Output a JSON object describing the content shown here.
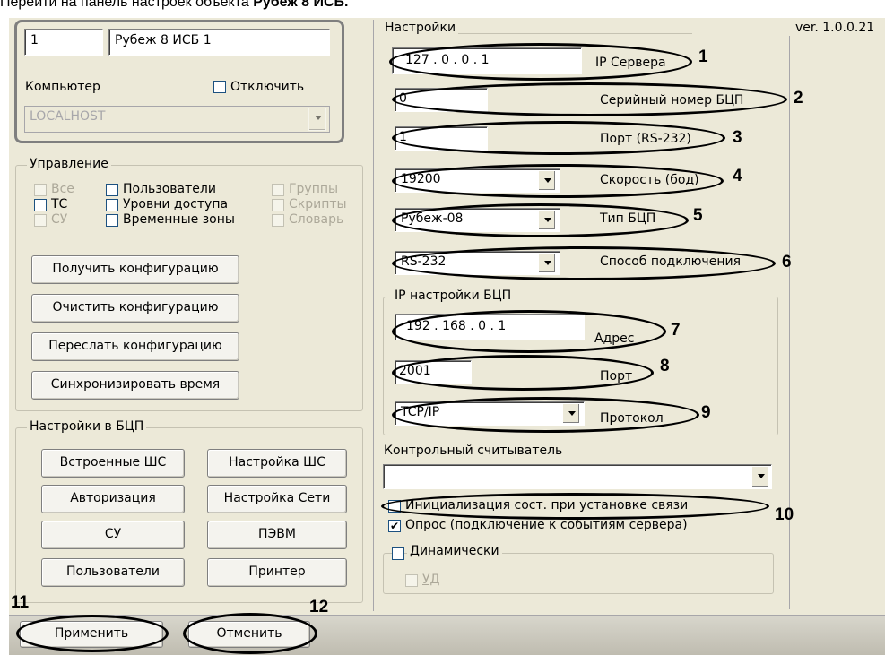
{
  "caption": {
    "prefix": "Перейти на панель настроек объекта",
    "bold": "Рубеж 8 ИСБ."
  },
  "version": "ver. 1.0.0.21",
  "object": {
    "id": "1",
    "name": "Рубеж 8 ИСБ 1",
    "computer_label": "Компьютер",
    "disable_label": "Отключить",
    "computer_value": "LOCALHOST"
  },
  "control": {
    "title": "Управление",
    "checkboxes": [
      "Все",
      "Пользователи",
      "Группы",
      "ТС",
      "Уровни доступа",
      "Скрипты",
      "СУ",
      "Временные зоны",
      "Словарь"
    ],
    "buttons": [
      "Получить конфигурацию",
      "Очистить конфигурацию",
      "Переслать конфигурацию",
      "Синхронизировать время"
    ]
  },
  "bcp_settings": {
    "title": "Настройки в БЦП",
    "buttons": [
      "Встроенные ШС",
      "Настройка ШС",
      "Авторизация",
      "Настройка Сети",
      "СУ",
      "ПЭВМ",
      "Пользователи",
      "Принтер"
    ]
  },
  "settings": {
    "title": "Настройки",
    "ip_server": {
      "value": "127 . 0 . 0 . 1",
      "label": "IP Сервера"
    },
    "serial": {
      "value": "0",
      "label": "Серийный номер БЦП"
    },
    "port": {
      "value": "1",
      "label": "Порт (RS-232)"
    },
    "speed": {
      "value": "19200",
      "label": "Скорость (бод)"
    },
    "type": {
      "value": "Рубеж-08",
      "label": "Тип БЦП"
    },
    "connection": {
      "value": "RS-232",
      "label": "Способ подключения"
    }
  },
  "ip_settings": {
    "title": "IP настройки БЦП",
    "address": {
      "value": "192 . 168 . 0 . 1",
      "label": "Адрес"
    },
    "port": {
      "value": "2001",
      "label": "Порт"
    },
    "protocol": {
      "value": "TCP/IP",
      "label": "Протокол"
    }
  },
  "reader": {
    "label": "Контрольный считыватель",
    "value": ""
  },
  "init_checkbox": "Инициализация сост. при установке связи",
  "poll_checkbox": "Опрос (подключение к событиям сервера)",
  "dynamic": {
    "title": "Динамически",
    "ud": "УД"
  },
  "footer": {
    "apply": "Применить",
    "cancel": "Отменить"
  },
  "callouts": [
    "1",
    "2",
    "3",
    "4",
    "5",
    "6",
    "7",
    "8",
    "9",
    "10",
    "11",
    "12"
  ]
}
